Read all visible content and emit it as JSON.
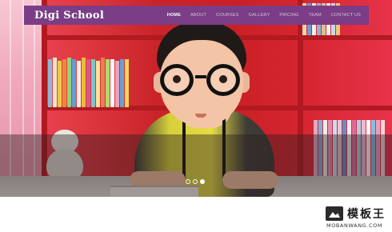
{
  "navbar": {
    "brand": "Digi School",
    "menu": [
      {
        "label": "HOME",
        "active": true
      },
      {
        "label": "ABOUT",
        "active": false
      },
      {
        "label": "COURSES",
        "active": false
      },
      {
        "label": "GALLERY",
        "active": false
      },
      {
        "label": "PRICING",
        "active": false
      },
      {
        "label": "TEAM",
        "active": false
      },
      {
        "label": "CONTACT US",
        "active": false
      }
    ]
  },
  "carousel": {
    "slide_count": 3,
    "active_slide": 3
  },
  "watermark": {
    "title": "模板王",
    "subtitle": "MOBANWANG.COM",
    "icon": "picture-icon"
  },
  "colors": {
    "navbar_bg": "#7a3d86",
    "shelf_red": "#cc1f25",
    "active_menu": "#ffffff"
  }
}
